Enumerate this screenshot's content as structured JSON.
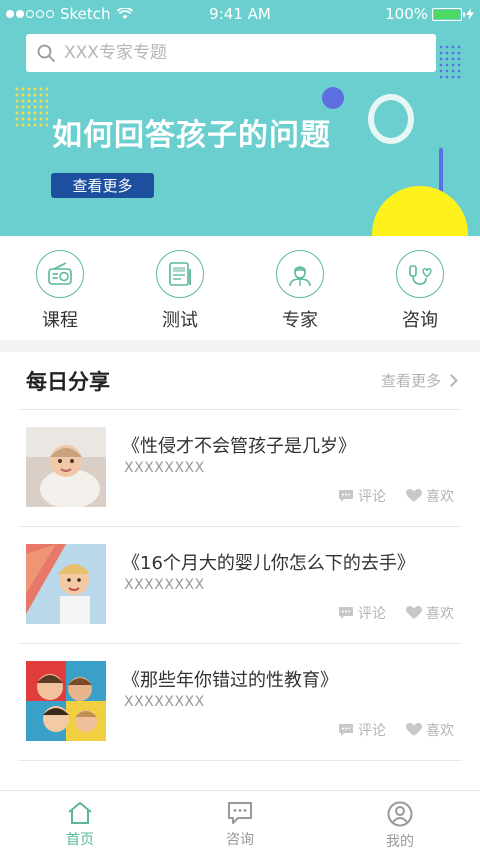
{
  "status_bar": {
    "carrier": "Sketch",
    "time": "9:41 AM",
    "battery": "100%"
  },
  "search": {
    "placeholder": "XXX专家专题"
  },
  "banner": {
    "title": "如何回答孩子的问题",
    "button_label": "查看更多"
  },
  "categories": [
    {
      "label": "课程",
      "icon": "radio-icon"
    },
    {
      "label": "测试",
      "icon": "test-paper-icon"
    },
    {
      "label": "专家",
      "icon": "doctor-icon"
    },
    {
      "label": "咨询",
      "icon": "stethoscope-icon"
    }
  ],
  "daily": {
    "title": "每日分享",
    "more_label": "查看更多"
  },
  "articles": [
    {
      "title": "《性侵才不会管孩子是几岁》",
      "subtitle": "XXXXXXXX",
      "comment_label": "评论",
      "like_label": "喜欢"
    },
    {
      "title": "《16个月大的婴儿你怎么下的去手》",
      "subtitle": "XXXXXXXX",
      "comment_label": "评论",
      "like_label": "喜欢"
    },
    {
      "title": "《那些年你错过的性教育》",
      "subtitle": "XXXXXXXX",
      "comment_label": "评论",
      "like_label": "喜欢"
    }
  ],
  "tabbar": {
    "tabs": [
      {
        "label": "首页",
        "icon": "home-icon",
        "active": true
      },
      {
        "label": "咨询",
        "icon": "chat-icon",
        "active": false
      },
      {
        "label": "我的",
        "icon": "user-icon",
        "active": false
      }
    ]
  },
  "colors": {
    "banner_bg": "#6ccfcf",
    "accent_green": "#5ab896",
    "button_blue": "#1d4f9f",
    "deco_yellow": "#fdf21c",
    "deco_purple": "#5d6ee0"
  }
}
